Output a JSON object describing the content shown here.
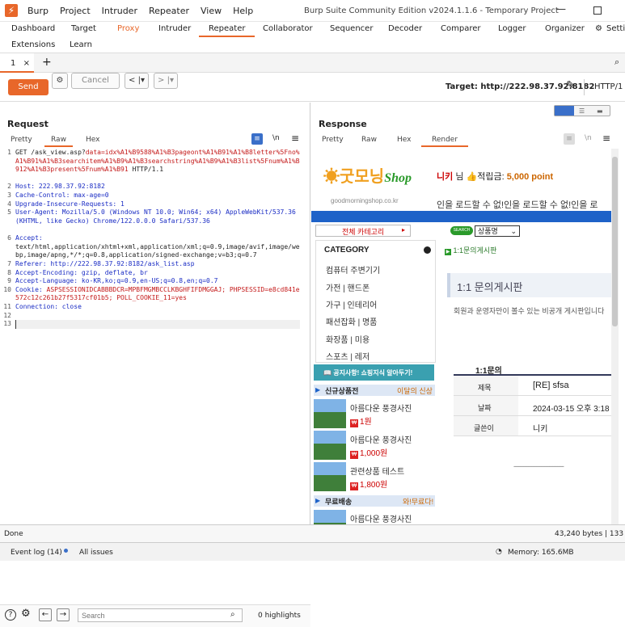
{
  "app": {
    "title": "Burp Suite Community Edition v2024.1.1.6 - Temporary Project",
    "menu": [
      "Burp",
      "Project",
      "Intruder",
      "Repeater",
      "View",
      "Help"
    ]
  },
  "main_tabs": [
    "Dashboard",
    "Target",
    "Proxy",
    "Intruder",
    "Repeater",
    "Collaborator",
    "Sequencer",
    "Decoder",
    "Comparer",
    "Logger",
    "Organizer",
    "Setti"
  ],
  "main_tabs2": [
    "Extensions",
    "Learn"
  ],
  "repeater_tab": {
    "label": "1",
    "close": "×",
    "add": "+"
  },
  "toolbar": {
    "send": "Send",
    "cancel": "Cancel",
    "target": "Target: http://222.98.37.92:8182",
    "http": "HTTP/1"
  },
  "request": {
    "title": "Request",
    "tabs": [
      "Pretty",
      "Raw",
      "Hex"
    ],
    "newline_glyph": "\\n",
    "lines": [
      {
        "n": "1",
        "t": "GET /ask_view.asp?"
      },
      {
        "n": "2",
        "t": "Host: 222.98.37.92:8182"
      },
      {
        "n": "3",
        "t": "Cache-Control: max-age=0"
      },
      {
        "n": "4",
        "t": "Upgrade-Insecure-Requests: 1"
      },
      {
        "n": "5",
        "t": "User-Agent: Mozilla/5.0 (Windows NT 10.0; Win64; x64) AppleWebKit/537.36 (KHTML, like Gecko) Chrome/122.0.0.0 Safari/537.36"
      },
      {
        "n": "6",
        "t": "Accept:"
      },
      {
        "n": "7",
        "t": "Referer: http://222.98.37.92:8182/ask_list.asp"
      },
      {
        "n": "8",
        "t": "Accept-Encoding: gzip, deflate, br"
      },
      {
        "n": "9",
        "t": "Accept-Language: ko-KR,ko;q=0.9,en-US;q=0.8,en;q=0.7"
      },
      {
        "n": "10",
        "t": "Cookie: "
      },
      {
        "n": "11",
        "t": "Connection: close"
      },
      {
        "n": "12",
        "t": ""
      },
      {
        "n": "13",
        "t": ""
      }
    ],
    "line1_param": "data=idx%A1%B9588%A1%B3pageont%A1%B91%A1%B8letter%5Fno%A1%B91%A1%B3searchitem%A1%B9%A1%B3searchstring%A1%B9%A1%B3list%5Fnum%A1%B912%A1%B3present%5Fnum%A1%B91",
    "line1_tail": " HTTP/1.1",
    "line6_value": "text/html,application/xhtml+xml,application/xml;q=0.9,image/avif,image/webp,image/apng,*/*;q=0.8,application/signed-exchange;v=b3;q=0.7",
    "cookie_value": "ASPSESSIONIDCABBBDCR=MPBFMGMBCCLKBGHFIFDMGGAJ; PHPSESSID=e8cd841e572c12c261b27f5317cf01b5; POLL_COOKIE_11=yes",
    "search_placeholder": "Search",
    "highlights": "0 highlights"
  },
  "response": {
    "title": "Response",
    "tabs": [
      "Pretty",
      "Raw",
      "Hex",
      "Render"
    ],
    "newline_glyph": "\\n"
  },
  "site": {
    "logo_text": "굿모닝",
    "logo_shop": "Shop",
    "domain": "goodmorningshop.co.kr",
    "user": "니키",
    "user_suffix": "님",
    "points_label": "적립금:",
    "points": "5,000 point",
    "marquee": "인을 로드할 수 없!인을 로드할 수 없!인을 로",
    "all_category": "전체 카테고리",
    "search_badge": "SEARCH",
    "search_select": "상품명",
    "breadcrumb": "1:1문의게시판",
    "category_title": "CATEGORY",
    "categories": [
      "컴퓨터 주변기기",
      "가전 | 핸드폰",
      "가구 | 인테리어",
      "패션잡화 | 명품",
      "화장품 | 미용",
      "스포츠 | 레저"
    ],
    "notice_banner": "공지사항! 쇼핑지식 알아두기!",
    "board_title": "1:1 문의게시판",
    "board_desc": "회원과 운영자만이 볼수 있는 비공개 게시판입니다",
    "new_products": "신규상품전",
    "new_products_more": "이달의 신상",
    "products": [
      {
        "name": "아름다운 풍경사진",
        "price": "1원"
      },
      {
        "name": "아름다운 풍경사진",
        "price": "1,000원"
      },
      {
        "name": "관련상품 테스트",
        "price": "1,800원"
      }
    ],
    "free_ship": "무료배송",
    "free_ship_more": "와!무료다!",
    "product4": "아름다운 풍경사진",
    "section_label": "1:1문의",
    "post": {
      "title_label": "제목",
      "title": "[RE] sfsa",
      "date_label": "날짜",
      "date": "2024-03-15 오후 3:18",
      "author_label": "글쓴이",
      "author": "니키"
    },
    "dashes": "-------------------------------"
  },
  "status": {
    "left": "Done",
    "right": "43,240 bytes | 133 m"
  },
  "bottom": {
    "event_log": "Event log (14)",
    "all_issues": "All issues",
    "memory": "Memory: 165.6MB"
  },
  "colors": {
    "accent": "#e8672a",
    "keyword": "#1a2cc4",
    "param": "#c41a1a",
    "site_blue": "#1e62c8"
  }
}
